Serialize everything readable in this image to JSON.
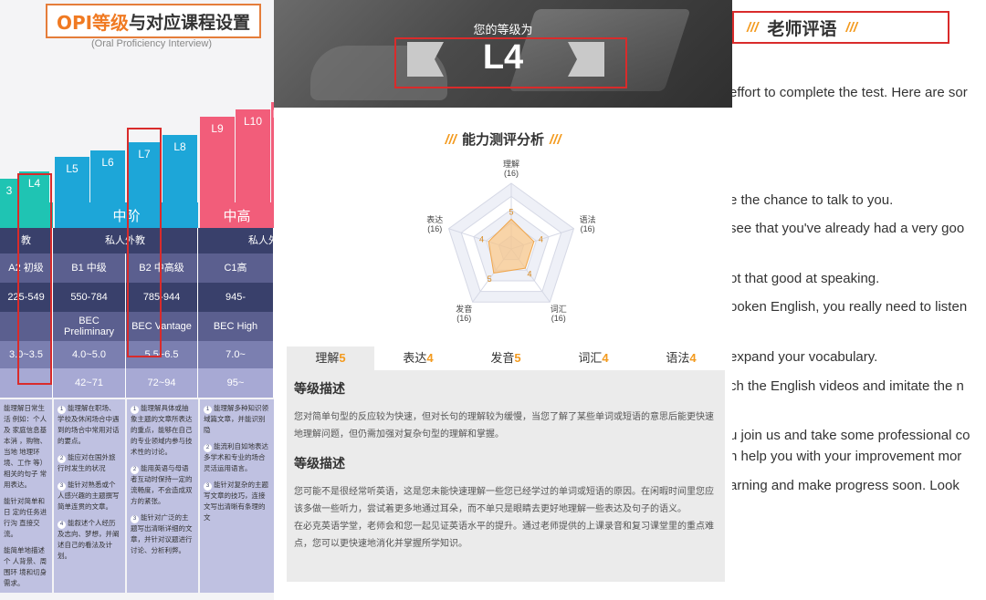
{
  "left": {
    "title_orange": "OPI等级",
    "title_black": "与对应课程设置",
    "subtitle": "(Oral Proficiency Interview)",
    "bars": [
      "3",
      "L4",
      "L5",
      "L6",
      "L7",
      "L8",
      "L9",
      "L10",
      "L"
    ],
    "bands": [
      "中阶",
      "中高"
    ],
    "row_teacher": [
      "教",
      "私人外教",
      "私人外"
    ],
    "row_cefr": [
      "A2 初级",
      "B1 中级",
      "B2 中高级",
      "C1高"
    ],
    "row_vocab": [
      "225-549",
      "550-784",
      "785-944",
      "945-"
    ],
    "row_bec": [
      "",
      "BEC Preliminary",
      "BEC Vantage",
      "BEC High"
    ],
    "row_ielts": [
      "3.0~3.5",
      "4.0~5.0",
      "5.5~6.5",
      "7.0~"
    ],
    "row_toefl": [
      "",
      "42~71",
      "72~94",
      "95~"
    ],
    "desc_col1": [
      "能理解日常生活 例如：个人及 家庭信息基本消 ，购物、当地 地理环境、工作 等）相关的句子 常用表达。",
      "能针对简单和日 定的任务进行沟 直接交流。",
      "能简单地描述个 人背景、周围环 境和切身需求。"
    ],
    "desc_col2": [
      "能理解在职场、学校及休闲场合中遇到的场合中常用对话的要点。",
      "能应对在国外旅行时发生的状况",
      "能针对熟悉或个人感兴趣的主题撰写简单连贯的文章。",
      "能叙述个人经历及志向、梦想，并阐述自己的看法及计划。"
    ],
    "desc_col3": [
      "能理解具体或抽象主题的文章所表达的重点，能够在自己的专业领域内参与技术性的讨论。",
      "能用英语与母语者互动时保持一定的流畅度，不会造成双方的紧张。",
      "能针对广泛的主题写出清晰详细的文章，并针对议题进行讨论、分析利弊。"
    ],
    "desc_col4": [
      "能理解多种知识领域篇文章，并能识别隐",
      "能流利自如地表达多学术和专业的场合灵活运用语言。",
      "能针对复杂的主题写文章的技巧，连接文写出清晰有条理的文"
    ]
  },
  "middle": {
    "hero_label": "您的等级为",
    "hero_level": "L4",
    "ability_title": "能力测评分析",
    "slash": "///",
    "radar": {
      "axes": [
        {
          "label": "理解",
          "max": "(16)",
          "score": "5"
        },
        {
          "label": "语法",
          "max": "(16)",
          "score": "4"
        },
        {
          "label": "词汇",
          "max": "(16)",
          "score": "4"
        },
        {
          "label": "发音",
          "max": "(16)",
          "score": "5"
        },
        {
          "label": "表达",
          "max": "(16)",
          "score": "4"
        }
      ]
    },
    "tabs": [
      {
        "label": "理解",
        "score": "5"
      },
      {
        "label": "表达",
        "score": "4"
      },
      {
        "label": "发音",
        "score": "5"
      },
      {
        "label": "词汇",
        "score": "4"
      },
      {
        "label": "语法",
        "score": "4"
      }
    ],
    "section1_title": "等级描述",
    "section1_text": "您对简单句型的反应较为快速，但对长句的理解较为缓慢，当您了解了某些单词或短语的意思后能更快速地理解问题，但仍需加强对复杂句型的理解和掌握。",
    "section2_title": "等级描述",
    "section2_text1": "您可能不是很经常听英语，这是您未能快速理解一些您已经学过的单词或短语的原因。在闲暇时间里您应该多做一些听力，尝试着更多地通过耳朵，而不单只是眼睛去更好地理解一些表达及句子的语义。",
    "section2_text2": "在必克英语学堂，老师会和您一起见证英语水平的提升。通过老师提供的上课录音和复习课堂里的重点难点，您可以更快速地消化并掌握所学知识。"
  },
  "right": {
    "title": "老师评语",
    "slash": "///",
    "lines": [
      "effort to complete the test. Here are sor",
      "e the chance to talk to you.",
      "see that you've already had a very goo",
      "ot that good at speaking.",
      "ooken English, you really need to listen",
      "expand your vocabulary.",
      "ch the English videos and imitate the n",
      "u join us and take some professional co",
      "n help you with your improvement mor",
      "arning and make progress soon. Look"
    ]
  },
  "colors": {
    "accent_orange": "#f39a1e",
    "highlight_red": "#d92b2b",
    "teal": "#1fc4b3",
    "blue": "#1da6d8",
    "pink": "#f25d7a",
    "navy": "#39406b"
  }
}
